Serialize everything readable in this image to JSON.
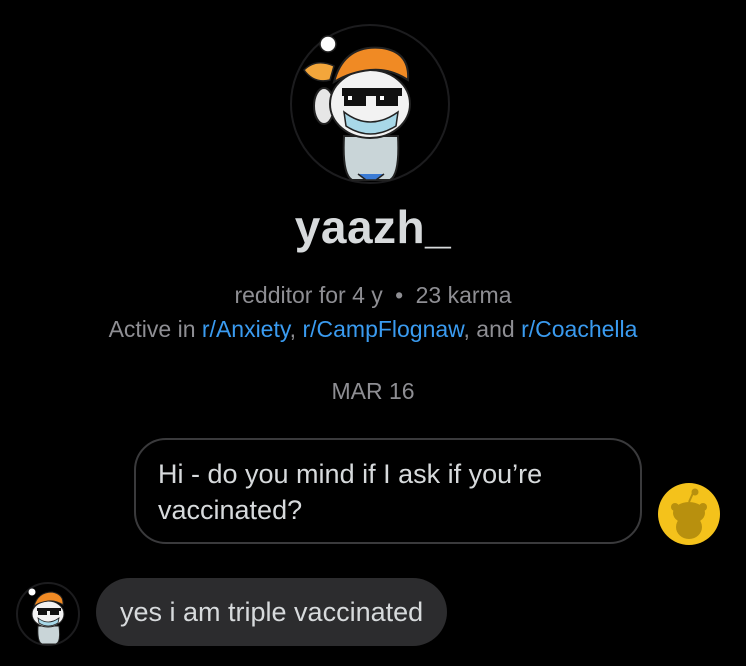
{
  "profile": {
    "username": "yaazh_",
    "tenure": "redditor for 4 y",
    "separator": "•",
    "karma": "23 karma",
    "active_prefix": "Active in ",
    "communities": [
      "r/Anxiety",
      "r/CampFlognaw",
      "r/Coachella"
    ],
    "comma": ", ",
    "and_text": ", and ",
    "avatar_icon": "snoo-sunglasses-mask-avatar-icon"
  },
  "chat": {
    "date": "MAR 16",
    "messages": [
      {
        "from": "me",
        "text": "Hi - do you mind if I ask if you’re vaccinated?",
        "avatar_icon": "default-yellow-snoo-icon"
      },
      {
        "from": "them",
        "text": "yes i am triple vaccinated",
        "avatar_icon": "snoo-sunglasses-mask-avatar-icon"
      }
    ]
  },
  "colors": {
    "background": "#000000",
    "text": "#d7dadc",
    "muted": "#8e8e93",
    "link": "#3a9bf0",
    "bubble_border": "#3a3a3c",
    "bubble_fill": "#2c2c2e",
    "default_avatar": "#f4c21b"
  }
}
